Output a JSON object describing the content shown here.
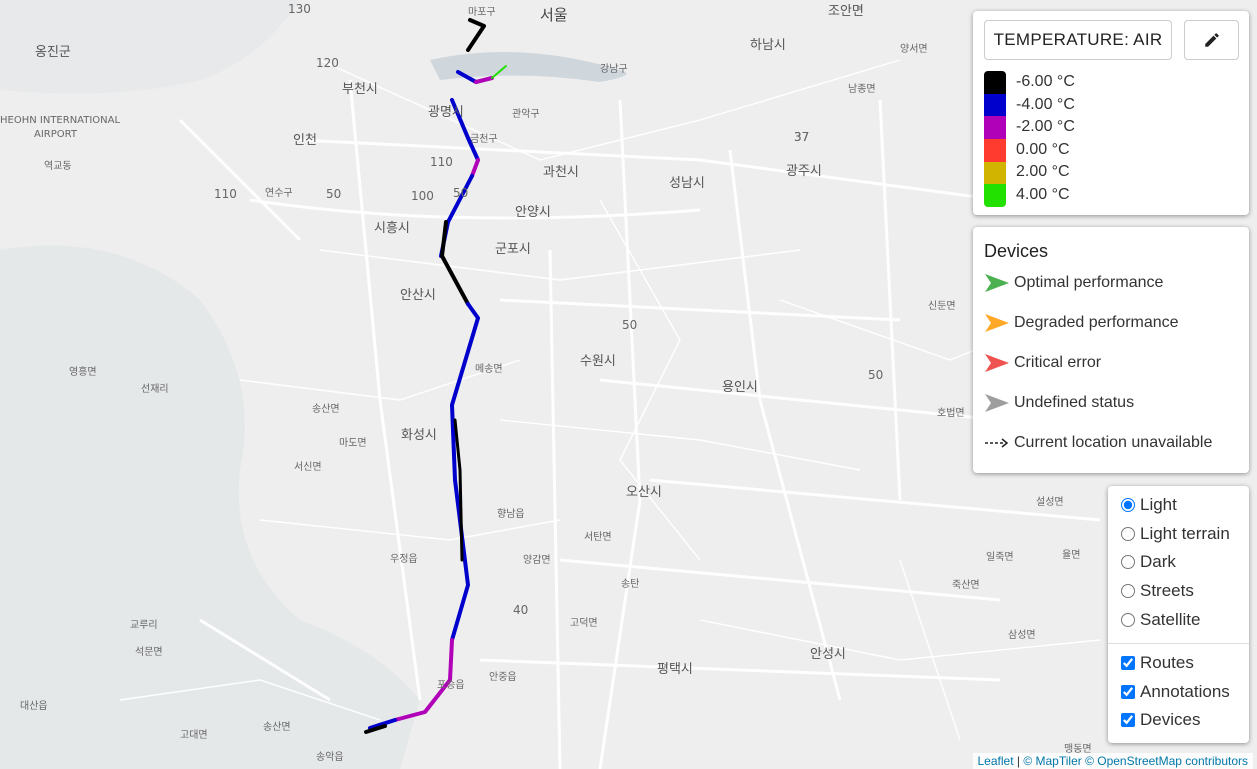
{
  "map": {
    "labels": [
      "서울",
      "마포구",
      "조안면",
      "하남시",
      "양서면",
      "옹진군",
      "부천시",
      "강남구",
      "남종면",
      "광명시",
      "관악구",
      "HEOHN INTERNATIONAL",
      "AIRPORT",
      "인천",
      "금천구",
      "37",
      "광주시",
      "역교동",
      "과천시",
      "성남시",
      "연수구",
      "시흥시",
      "안양시",
      "군포시",
      "안산시",
      "신둔면",
      "수원시",
      "메송면",
      "영흥면",
      "선재리",
      "용인시",
      "송산면",
      "마도면",
      "화성시",
      "호법면",
      "서신면",
      "오산시",
      "설성면",
      "향남읍",
      "서탄면",
      "우정읍",
      "양감면",
      "일죽면",
      "율면",
      "송탄",
      "죽산면",
      "고덕면",
      "교루리",
      "석문면",
      "평택시",
      "안성시",
      "삼성면",
      "대산읍",
      "포승읍",
      "안중읍",
      "송산면",
      "고대면",
      "송악읍",
      "맹동면"
    ],
    "road_numbers": [
      "130",
      "120",
      "110",
      "50",
      "100",
      "110",
      "50",
      "37",
      "50",
      "40",
      "50"
    ]
  },
  "route_colors": {
    "black": "#000000",
    "blue": "#0000cc",
    "magenta": "#b000b8",
    "red": "#ff3b30",
    "yellow": "#d0b400",
    "green": "#22e000"
  },
  "legend": {
    "metric_label": "TEMPERATURE: AIR",
    "edit_icon": "pencil-icon",
    "scale": [
      {
        "label": "-6.00 °C",
        "color": "#000000"
      },
      {
        "label": "-4.00 °C",
        "color": "#0000cc"
      },
      {
        "label": "-2.00 °C",
        "color": "#b000b8"
      },
      {
        "label": "0.00 °C",
        "color": "#ff3b30"
      },
      {
        "label": "2.00 °C",
        "color": "#d0b400"
      },
      {
        "label": "4.00 °C",
        "color": "#22e000"
      }
    ]
  },
  "devices": {
    "title": "Devices",
    "items": [
      {
        "label": "Optimal performance",
        "color": "#4caf50"
      },
      {
        "label": "Degraded performance",
        "color": "#ffa726"
      },
      {
        "label": "Critical error",
        "color": "#ef5350"
      },
      {
        "label": "Undefined status",
        "color": "#9e9e9e"
      },
      {
        "label": "Current location unavailable",
        "icon": "dashed-arrow-icon"
      }
    ]
  },
  "layers": {
    "base": [
      {
        "label": "Light",
        "checked": true
      },
      {
        "label": "Light terrain",
        "checked": false
      },
      {
        "label": "Dark",
        "checked": false
      },
      {
        "label": "Streets",
        "checked": false
      },
      {
        "label": "Satellite",
        "checked": false
      }
    ],
    "overlays": [
      {
        "label": "Routes",
        "checked": true
      },
      {
        "label": "Annotations",
        "checked": true
      },
      {
        "label": "Devices",
        "checked": true
      }
    ]
  },
  "attribution": {
    "leaflet": "Leaflet",
    "sep": " | ",
    "maptiler": "© MapTiler",
    "osm": "© OpenStreetMap contributors"
  }
}
